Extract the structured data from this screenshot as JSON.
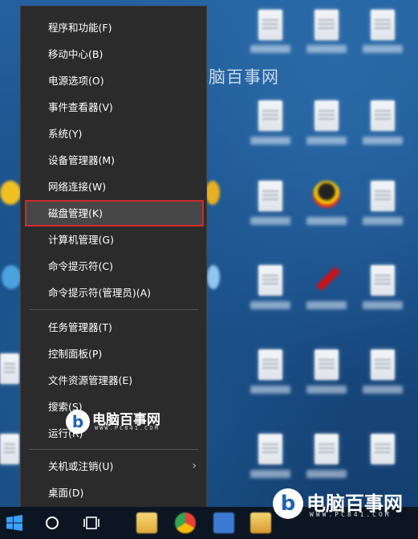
{
  "watermark": {
    "brand": "电脑百事网",
    "url": "WWW.PC841.COM"
  },
  "menu": {
    "items": [
      {
        "label": "程序和功能(F)"
      },
      {
        "label": "移动中心(B)"
      },
      {
        "label": "电源选项(O)"
      },
      {
        "label": "事件查看器(V)"
      },
      {
        "label": "系统(Y)"
      },
      {
        "label": "设备管理器(M)"
      },
      {
        "label": "网络连接(W)"
      },
      {
        "label": "磁盘管理(K)",
        "highlighted": true
      },
      {
        "label": "计算机管理(G)"
      },
      {
        "label": "命令提示符(C)"
      },
      {
        "label": "命令提示符(管理员)(A)"
      },
      {
        "label": "任务管理器(T)"
      },
      {
        "label": "控制面板(P)"
      },
      {
        "label": "文件资源管理器(E)"
      },
      {
        "label": "搜索(S)"
      },
      {
        "label": "运行(R)"
      },
      {
        "label": "关机或注销(U)",
        "submenu": true
      },
      {
        "label": "桌面(D)"
      }
    ],
    "submenu_arrow": "›"
  },
  "colors": {
    "menu_bg": "#2b2b2b",
    "highlight_border": "#d02a2a",
    "taskbar_bg": "#0c1622",
    "desktop_bg": "#1a4f86"
  },
  "icons": {
    "start": "windows-logo-icon",
    "search": "cortana-circle-icon",
    "task_view": "task-view-icon"
  }
}
